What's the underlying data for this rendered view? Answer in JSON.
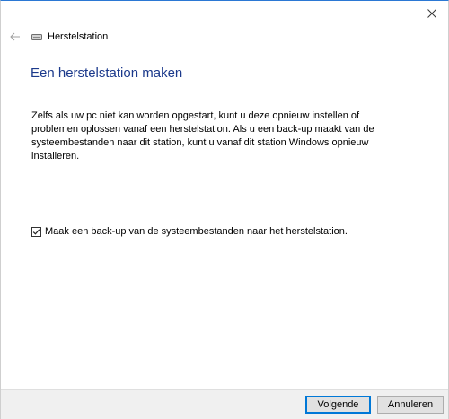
{
  "header": {
    "title": "Herstelstation"
  },
  "page": {
    "title": "Een herstelstation maken",
    "description": "Zelfs als uw pc niet kan worden opgestart, kunt u deze opnieuw instellen of problemen oplossen vanaf een herstelstation. Als u een back-up maakt van de systeembestanden naar dit station, kunt u vanaf dit station Windows opnieuw installeren."
  },
  "backup_option": {
    "label": "Maak een back-up van de systeembestanden naar het herstelstation.",
    "checked": true
  },
  "footer": {
    "next_label": "Volgende",
    "cancel_label": "Annuleren"
  },
  "icons": {
    "close": "close-icon",
    "back": "back-arrow-icon",
    "drive": "drive-icon",
    "check": "checkmark-icon"
  },
  "colors": {
    "title": "#1c3a8c",
    "accent": "#0078d7",
    "footer_bg": "#f0f0f0"
  }
}
